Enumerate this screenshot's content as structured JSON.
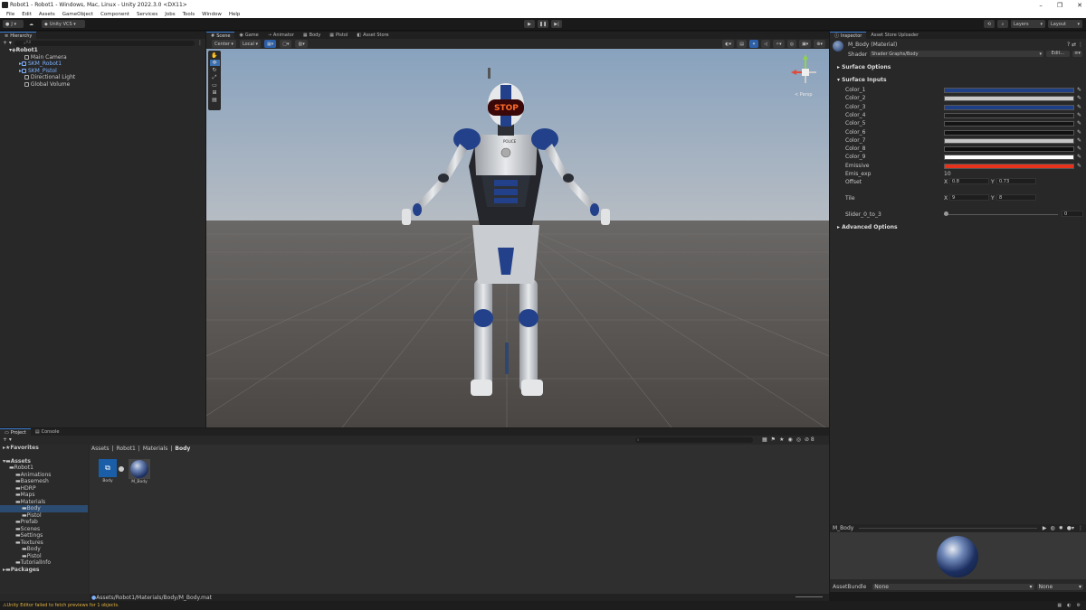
{
  "title": "Robot1 - Robot1 - Windows, Mac, Linux - Unity 2022.3.0 <DX11>",
  "window_controls": [
    "–",
    "❐",
    "✕"
  ],
  "menu": [
    "File",
    "Edit",
    "Assets",
    "GameObject",
    "Component",
    "Services",
    "Jobs",
    "Tools",
    "Window",
    "Help"
  ],
  "toolbar": {
    "account": "J ▾",
    "vcs": "Unity VCS ▾",
    "layers": "Layers",
    "layout": "Layout"
  },
  "hierarchy": {
    "tab": "Hierarchy",
    "search": "All",
    "scene": "Robot1",
    "items": [
      "Main Camera",
      "SKM_Robot1",
      "SKM_Pistol",
      "Directional Light",
      "Global Volume"
    ]
  },
  "scene_tabs": [
    "Scene",
    "Game",
    "Animator",
    "Body",
    "Pistol",
    "Asset Store"
  ],
  "scene_toolbar": {
    "pivot": "Center ▾",
    "space": "Local ▾"
  },
  "scene": {
    "persp": "< Persp",
    "sign": "STOP",
    "badge": "POLICE"
  },
  "inspector": {
    "tabs": [
      "Inspector",
      "Asset Store Uploader"
    ],
    "name": "M_Body (Material)",
    "shader_label": "Shader",
    "shader": "Shader Graphs/Body",
    "edit": "Edit...",
    "surface_options": "Surface Options",
    "surface_inputs": "Surface Inputs",
    "colors": [
      {
        "label": "Color_1",
        "color": "#1f3f86"
      },
      {
        "label": "Color_2",
        "color": "#c9c9c9"
      },
      {
        "label": "Color_3",
        "color": "#1f3f86"
      },
      {
        "label": "Color_4",
        "color": "#1e1e1e"
      },
      {
        "label": "Color_5",
        "color": "#141414"
      },
      {
        "label": "Color_6",
        "color": "#111111"
      },
      {
        "label": "Color_7",
        "color": "#c4c4c4"
      },
      {
        "label": "Color_8",
        "color": "#0e0e0e"
      },
      {
        "label": "Color_9",
        "color": "#ffffff"
      },
      {
        "label": "Emissive",
        "color": "#e8331c"
      }
    ],
    "emis_label": "Emis_exp",
    "emis_value": "10",
    "offset_label": "Offset",
    "offset_x": "0.8",
    "offset_y": "0.73",
    "tile_label": "Tile",
    "tile_x": "9",
    "tile_y": "8",
    "slider_label": "Slider_0_to_3",
    "slider_value": "0",
    "slider_fraction": 0,
    "advanced": "Advanced Options",
    "preview_name": "M_Body",
    "assetbundle_label": "AssetBundle",
    "assetbundle": "None",
    "assetbundle_variant": "None"
  },
  "project": {
    "tabs": [
      "Project",
      "Console"
    ],
    "favorites": "Favorites",
    "assets": "Assets",
    "packages": "Packages",
    "tree": [
      {
        "label": "Robot1",
        "indent": 1
      },
      {
        "label": "Animations",
        "indent": 2
      },
      {
        "label": "Basemesh",
        "indent": 2
      },
      {
        "label": "HDRP",
        "indent": 2
      },
      {
        "label": "Maps",
        "indent": 2
      },
      {
        "label": "Materials",
        "indent": 2
      },
      {
        "label": "Body",
        "indent": 3
      },
      {
        "label": "Pistol",
        "indent": 3
      },
      {
        "label": "Prefab",
        "indent": 2
      },
      {
        "label": "Scenes",
        "indent": 2
      },
      {
        "label": "Settings",
        "indent": 2
      },
      {
        "label": "Textures",
        "indent": 2
      },
      {
        "label": "Body",
        "indent": 3
      },
      {
        "label": "Pistol",
        "indent": 3
      },
      {
        "label": "TutorialInfo",
        "indent": 2
      }
    ],
    "breadcrumb": [
      "Assets",
      "Robot1",
      "Materials",
      "Body"
    ],
    "files": [
      "Body",
      "M_Body"
    ],
    "path": "Assets/Robot1/Materials/Body/M_Body.mat"
  },
  "status": "Unity Editor failed to fetch previews for 1 objects."
}
